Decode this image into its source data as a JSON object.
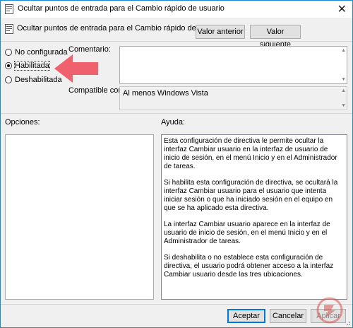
{
  "window": {
    "title": "Ocultar puntos de entrada para el Cambio rápido de usuario",
    "close_glyph": "✕",
    "close_icon": "close-icon",
    "title_icon": "policy-icon"
  },
  "header": {
    "setting_name": "Ocultar puntos de entrada para el Cambio rápido de usuario",
    "prev_label": "Valor anterior",
    "next_label": "Valor siguiente"
  },
  "state": {
    "options": [
      {
        "label": "No configurada",
        "selected": false
      },
      {
        "label": "Habilitada",
        "selected": true
      },
      {
        "label": "Deshabilitada",
        "selected": false
      }
    ]
  },
  "comment": {
    "label": "Comentario:",
    "value": ""
  },
  "compatible": {
    "label": "Compatible con:",
    "value": "Al menos Windows Vista"
  },
  "options_panel": {
    "label": "Opciones:"
  },
  "help_panel": {
    "label": "Ayuda:",
    "paragraphs": [
      "Esta configuración de directiva le permite ocultar la interfaz Cambiar usuario en la interfaz de usuario de inicio de sesión, en el menú Inicio y en el Administrador de tareas.",
      "Si habilita esta configuración de directiva, se ocultará la interfaz Cambiar usuario para el usuario que intenta iniciar sesión o que ha iniciado sesión en el equipo en que se ha aplicado esta directiva.",
      "La interfaz Cambiar usuario aparece en la interfaz de usuario de inicio de sesión, en el menú Inicio y en el Administrador de tareas.",
      "Si deshabilita o no establece esta configuración de directiva, el usuario podrá obtener acceso a la interfaz Cambiar usuario desde las tres ubicaciones."
    ]
  },
  "footer": {
    "ok_label": "Aceptar",
    "cancel_label": "Cancelar",
    "apply_label": "Aplicar"
  },
  "colors": {
    "accent": "#0078d7",
    "annotation_arrow": "#f0616e",
    "watermark": "#d9534f"
  }
}
